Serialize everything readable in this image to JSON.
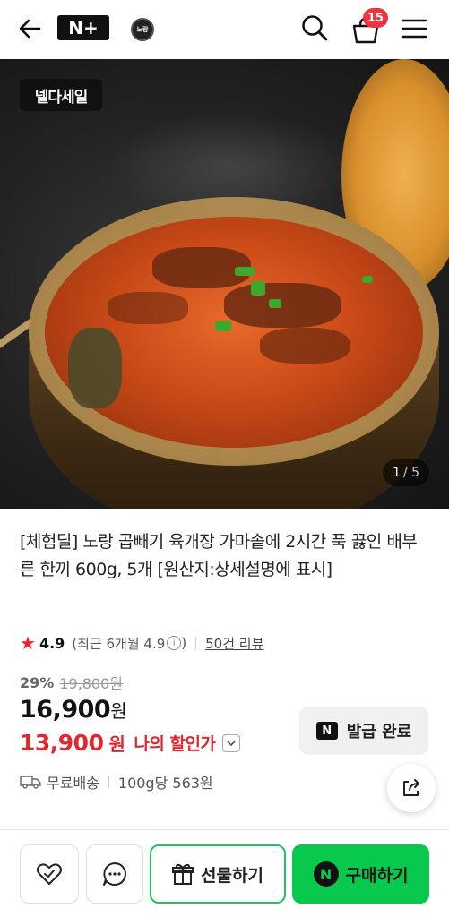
{
  "header": {
    "logo_text": "N+",
    "brand_logo_text": "노랑",
    "cart_count": "15"
  },
  "hero": {
    "sale_badge": "넬다세일",
    "page_current": "1",
    "page_total": "/ 5"
  },
  "product": {
    "title": "[체험딜] 노랑 곱빼기 육개장 가마솥에 2시간 푹 끓인 배부른 한끼 600g, 5개 [원산지:상세설명에 표시]",
    "rating": "4.9",
    "rating_recent": "(최근 6개월 4.9",
    "reviews": "50건 리뷰",
    "discount_rate": "29%",
    "original_price": "19,800원",
    "sale_price": "16,900",
    "sale_unit": "원",
    "my_price": "13,900",
    "my_price_unit": "원",
    "my_price_label": "나의 할인가",
    "coupon_label": "발급 완료",
    "shipping": "무료배송",
    "unit_price": "100g당 563원"
  },
  "bottom_bar": {
    "gift_label": "선물하기",
    "buy_label": "구매하기"
  }
}
